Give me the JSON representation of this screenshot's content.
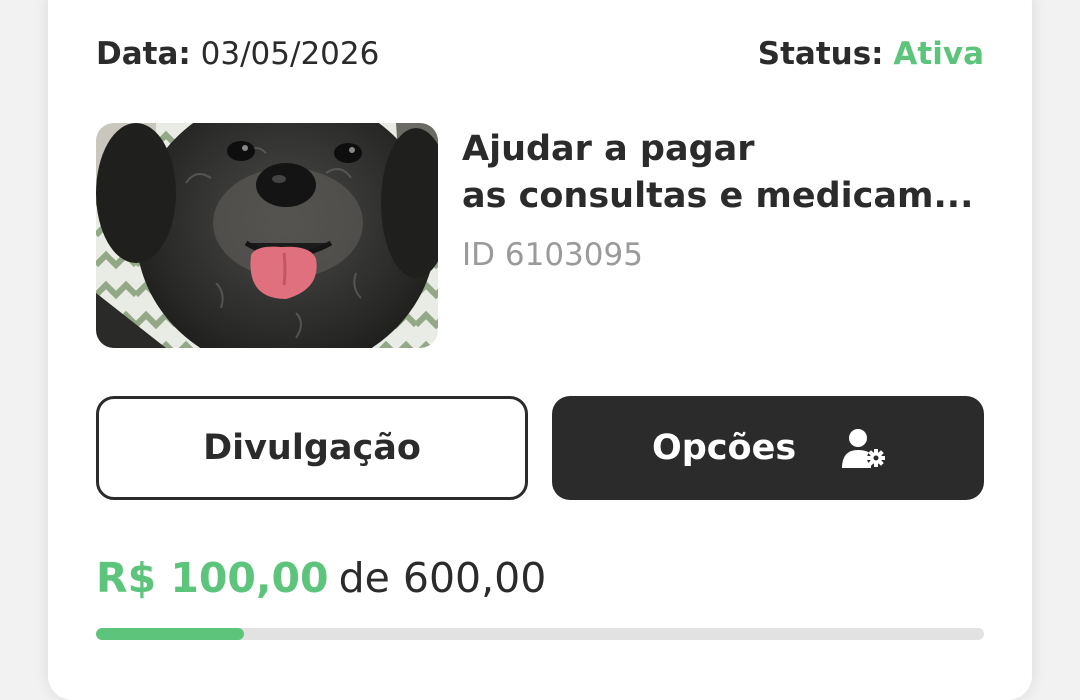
{
  "header": {
    "date_label": "Data:",
    "date_value": "03/05/2026",
    "status_label": "Status:",
    "status_value": "Ativa",
    "status_color": "#5cc47b"
  },
  "campaign": {
    "image_icon": "dog-photo",
    "title_line1": "Ajudar a pagar",
    "title_line2": "as consultas e medicam...",
    "id_text": "ID 6103095"
  },
  "actions": {
    "share_label": "Divulgação",
    "options_label": "Opcões",
    "options_icon": "user-gear-icon"
  },
  "funding": {
    "raised": "R$ 100,00",
    "of_goal": "de 600,00",
    "progress_fraction": 0.1667,
    "accent_color": "#5cc47b",
    "dark_color": "#2b2b2b"
  }
}
